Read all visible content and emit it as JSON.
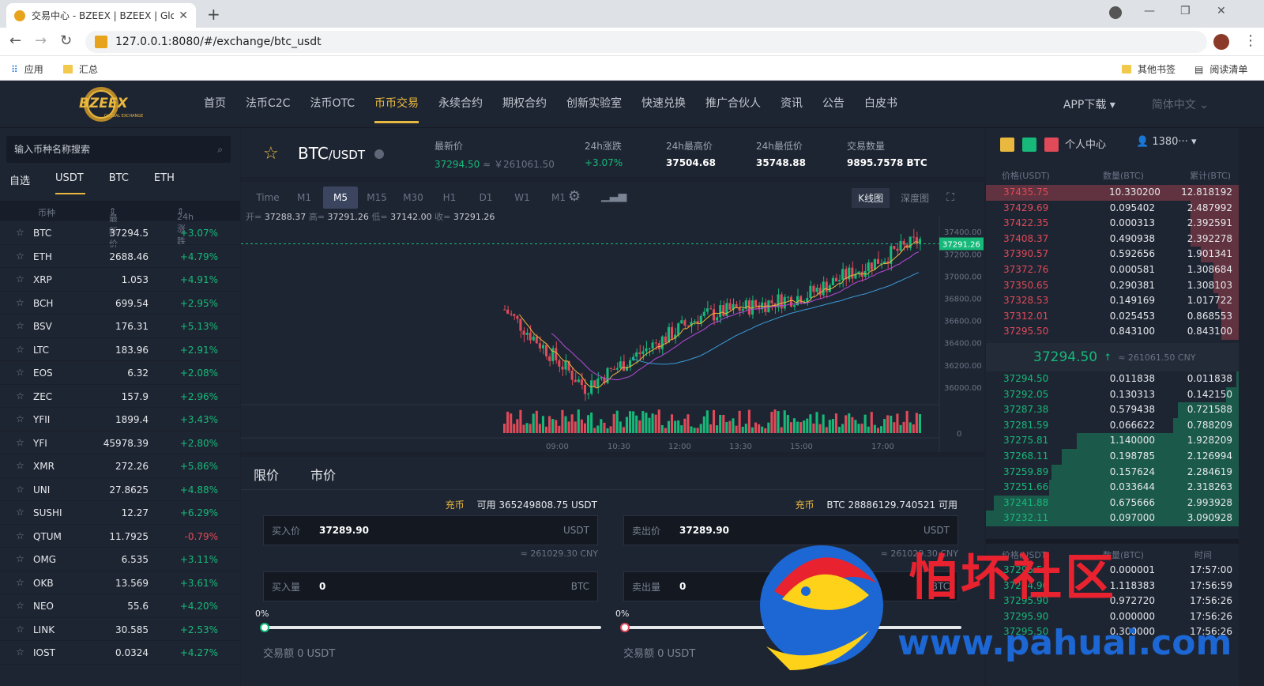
{
  "browser": {
    "tab_title": "交易中心 - BZEEX | BZEEX | Glo",
    "url": "127.0.0.1:8080/#/exchange/btc_usdt",
    "bookmarks": [
      "应用",
      "汇总"
    ],
    "bookmarks_right": [
      "其他书签",
      "阅读清单"
    ]
  },
  "header": {
    "logo_text": "BZEEX",
    "logo_sub": "GLOBAL EXCHANGE",
    "nav": [
      "首页",
      "法币C2C",
      "法币OTC",
      "币币交易",
      "永续合约",
      "期权合约",
      "创新实验室",
      "快速兑换",
      "推广合伙人",
      "资讯",
      "公告",
      "白皮书"
    ],
    "active_nav": "币币交易",
    "app_download": "APP下载",
    "language": "简体中文"
  },
  "market": {
    "search_placeholder": "输入币种名称搜索",
    "tabs": [
      "自选",
      "USDT",
      "BTC",
      "ETH"
    ],
    "active_tab": "USDT",
    "col_coin": "币种",
    "col_price": "最新价",
    "col_change": "24h涨跌",
    "rows": [
      {
        "sym": "BTC",
        "price": "37294.5",
        "change": "+3.07%"
      },
      {
        "sym": "ETH",
        "price": "2688.46",
        "change": "+4.79%"
      },
      {
        "sym": "XRP",
        "price": "1.053",
        "change": "+4.91%"
      },
      {
        "sym": "BCH",
        "price": "699.54",
        "change": "+2.95%"
      },
      {
        "sym": "BSV",
        "price": "176.31",
        "change": "+5.13%"
      },
      {
        "sym": "LTC",
        "price": "183.96",
        "change": "+2.91%"
      },
      {
        "sym": "EOS",
        "price": "6.32",
        "change": "+2.08%"
      },
      {
        "sym": "ZEC",
        "price": "157.9",
        "change": "+2.96%"
      },
      {
        "sym": "YFII",
        "price": "1899.4",
        "change": "+3.43%"
      },
      {
        "sym": "YFI",
        "price": "45978.39",
        "change": "+2.80%"
      },
      {
        "sym": "XMR",
        "price": "272.26",
        "change": "+5.86%"
      },
      {
        "sym": "UNI",
        "price": "27.8625",
        "change": "+4.88%"
      },
      {
        "sym": "SUSHI",
        "price": "12.27",
        "change": "+6.29%"
      },
      {
        "sym": "QTUM",
        "price": "11.7925",
        "change": "-0.79%"
      },
      {
        "sym": "OMG",
        "price": "6.535",
        "change": "+3.11%"
      },
      {
        "sym": "OKB",
        "price": "13.569",
        "change": "+3.61%"
      },
      {
        "sym": "NEO",
        "price": "55.6",
        "change": "+4.20%"
      },
      {
        "sym": "LINK",
        "price": "30.585",
        "change": "+2.53%"
      },
      {
        "sym": "IOST",
        "price": "0.0324",
        "change": "+4.27%"
      }
    ]
  },
  "pair": {
    "base": "BTC",
    "quote": "/USDT",
    "last_label": "最新价",
    "last_price": "37294.50",
    "last_cny": "≈ ￥261061.50",
    "change_label": "24h涨跌",
    "change": "+3.07%",
    "high_label": "24h最高价",
    "high": "37504.68",
    "low_label": "24h最低价",
    "low": "35748.88",
    "vol_label": "交易数量",
    "vol": "9895.7578 BTC"
  },
  "chart": {
    "timeframes": [
      "Time",
      "M1",
      "M5",
      "M15",
      "M30",
      "H1",
      "D1",
      "W1",
      "M1"
    ],
    "active_tf": "M5",
    "mode_k": "K线图",
    "mode_depth": "深度图",
    "ohlc": {
      "o_label": "开=",
      "o": "37288.37",
      "h_label": "高=",
      "h": "37291.26",
      "l_label": "低=",
      "l": "37142.00",
      "c_label": "收=",
      "c": "37291.26"
    },
    "y_ticks": [
      "37400.00",
      "37200.00",
      "37000.00",
      "36800.00",
      "36600.00",
      "36400.00",
      "36200.00",
      "36000.00"
    ],
    "x_ticks": [
      "09:00",
      "10:30",
      "12:00",
      "13:30",
      "15:00",
      "17:00"
    ],
    "current_price_tag": "37291.26",
    "vol_zero": "0"
  },
  "order": {
    "tabs": [
      "限价",
      "市价"
    ],
    "active_tab": "限价",
    "buy": {
      "charge": "充币",
      "avail": "可用 365249808.75 USDT",
      "price_label": "买入价",
      "price": "37289.90",
      "price_unit": "USDT",
      "cny": "≈ 261029.30 CNY",
      "amount_label": "买入量",
      "amount": "0",
      "amount_unit": "BTC",
      "pct": "0%",
      "slider_level": 0,
      "total": "交易额 0 USDT"
    },
    "sell": {
      "charge": "充币",
      "avail": "BTC 28886129.740521 可用",
      "price_label": "卖出价",
      "price": "37289.90",
      "price_unit": "USDT",
      "cny": "≈ 261029.30 CNY",
      "amount_label": "卖出量",
      "amount": "0",
      "amount_unit": "BTC",
      "pct": "0%",
      "slider_level": 0,
      "total": "交易额 0 USDT"
    }
  },
  "orderbook": {
    "user_center": "个人中心",
    "account": "1380···",
    "col_price": "价格(USDT)",
    "col_amount": "数量(BTC)",
    "col_total": "累计(BTC)",
    "asks": [
      {
        "p": "37435.75",
        "a": "10.330200",
        "t": "12.818192",
        "d": 1.0
      },
      {
        "p": "37429.69",
        "a": "0.095402",
        "t": "2.487992",
        "d": 0.19
      },
      {
        "p": "37422.35",
        "a": "0.000313",
        "t": "2.392591",
        "d": 0.19
      },
      {
        "p": "37408.37",
        "a": "0.490938",
        "t": "2.392278",
        "d": 0.19
      },
      {
        "p": "37390.57",
        "a": "0.592656",
        "t": "1.901341",
        "d": 0.15
      },
      {
        "p": "37372.76",
        "a": "0.000581",
        "t": "1.308684",
        "d": 0.1
      },
      {
        "p": "37350.65",
        "a": "0.290381",
        "t": "1.308103",
        "d": 0.1
      },
      {
        "p": "37328.53",
        "a": "0.149169",
        "t": "1.017722",
        "d": 0.08
      },
      {
        "p": "37312.01",
        "a": "0.025453",
        "t": "0.868553",
        "d": 0.07
      },
      {
        "p": "37295.50",
        "a": "0.843100",
        "t": "0.843100",
        "d": 0.07
      }
    ],
    "mid_price": "37294.50",
    "mid_arrow": "↑",
    "mid_cny": "≈ 261061.50 CNY",
    "bids": [
      {
        "p": "37294.50",
        "a": "0.011838",
        "t": "0.011838",
        "d": 0.01
      },
      {
        "p": "37292.05",
        "a": "0.130313",
        "t": "0.142150",
        "d": 0.05
      },
      {
        "p": "37287.38",
        "a": "0.579438",
        "t": "0.721588",
        "d": 0.24
      },
      {
        "p": "37281.59",
        "a": "0.066622",
        "t": "0.788209",
        "d": 0.26
      },
      {
        "p": "37275.81",
        "a": "1.140000",
        "t": "1.928209",
        "d": 0.64
      },
      {
        "p": "37268.11",
        "a": "0.198785",
        "t": "2.126994",
        "d": 0.7
      },
      {
        "p": "37259.89",
        "a": "0.157624",
        "t": "2.284619",
        "d": 0.74
      },
      {
        "p": "37251.66",
        "a": "0.033644",
        "t": "2.318263",
        "d": 0.75
      },
      {
        "p": "37241.88",
        "a": "0.675666",
        "t": "2.993928",
        "d": 0.97
      },
      {
        "p": "37232.11",
        "a": "0.097000",
        "t": "3.090928",
        "d": 1.0
      }
    ]
  },
  "trades": {
    "col_price": "价格(USDT)",
    "col_amount": "数量(BTC)",
    "col_time": "时间",
    "rows": [
      {
        "p": "37295.50",
        "a": "0.000001",
        "t": "17:57:00"
      },
      {
        "p": "37294.90",
        "a": "1.118383",
        "t": "17:56:59"
      },
      {
        "p": "37295.90",
        "a": "0.972720",
        "t": "17:56:26"
      },
      {
        "p": "37295.90",
        "a": "0.000000",
        "t": "17:56:26"
      },
      {
        "p": "37295.50",
        "a": "0.300000",
        "t": "17:56:26"
      }
    ]
  },
  "watermark": {
    "cn": "怕坏社区",
    "url": "www.pahuai.com"
  },
  "colors": {
    "up": "#16b979",
    "down": "#e04a59",
    "accent": "#e9b83e"
  }
}
